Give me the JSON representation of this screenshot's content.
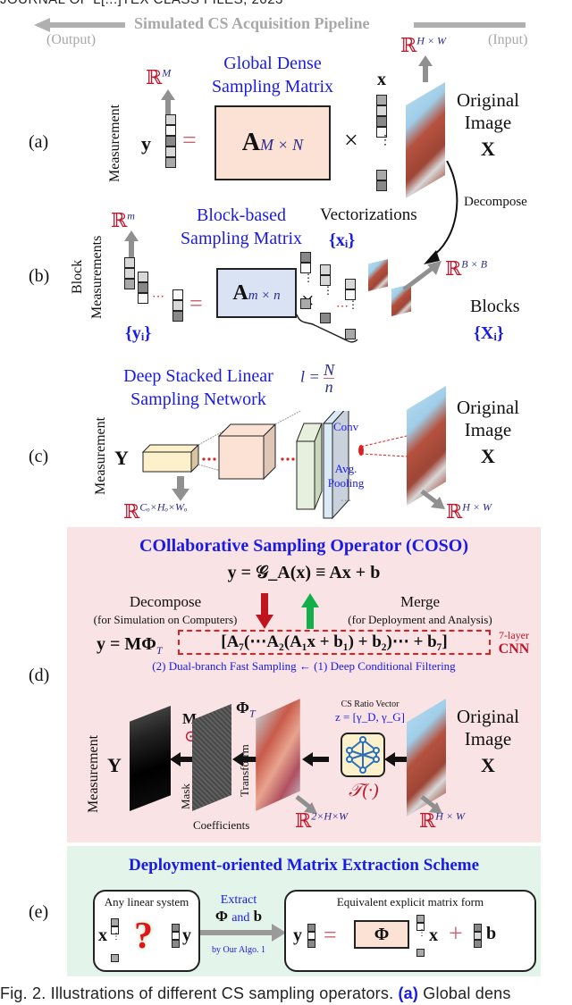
{
  "header": {
    "running_title": "JOURNAL OF L[...]TEX CLASS FILES, 2023"
  },
  "pipeline": {
    "title": "Simulated CS Acquisition Pipeline",
    "output_label": "(Output)",
    "input_label": "(Input)"
  },
  "panel_a": {
    "label": "(a)",
    "side_label": "Measurement",
    "title_line1": "Global Dense",
    "title_line2": "Sampling Matrix",
    "measurement_space": "ℝ",
    "measurement_space_sup": "M",
    "y_symbol": "y",
    "equals": "=",
    "matrix_symbol": "A",
    "matrix_sub": "M × N",
    "times": "×",
    "x_symbol": "x",
    "image_space": "ℝ",
    "image_space_sup": "H × W",
    "image_label_line1": "Original",
    "image_label_line2": "Image",
    "image_symbol": "X",
    "decompose_label": "Decompose",
    "vectorizations_label": "Vectorizations"
  },
  "panel_b": {
    "label": "(b)",
    "side_label_line1": "Block",
    "side_label_line2": "Measurements",
    "title_line1": "Block-based",
    "title_line2": "Sampling Matrix",
    "measurement_space": "ℝ",
    "measurement_space_sup": "m",
    "y_set": "{yᵢ}",
    "matrix_symbol": "A",
    "matrix_sub": "m × n",
    "x_set": "{xᵢ}",
    "block_space": "ℝ",
    "block_space_sup": "B × B",
    "blocks_label": "Blocks",
    "blocks_set": "{Xᵢ}",
    "l_formula_lhs": "l =",
    "l_formula_num": "N",
    "l_formula_den": "n"
  },
  "panel_c": {
    "label": "(c)",
    "side_label": "Measurement",
    "title_line1": "Deep Stacked Linear",
    "title_line2": "Sampling Network",
    "y_symbol": "Y",
    "measurement_space": "ℝ",
    "measurement_space_sup": "Cₒ×Hₒ×Wₒ",
    "conv_label": "Conv",
    "pool_label_line1": "Avg.",
    "pool_label_line2": "Pooling",
    "ellipsis": "…",
    "image_label_line1": "Original",
    "image_label_line2": "Image",
    "image_symbol": "X",
    "image_space": "ℝ",
    "image_space_sup": "H × W"
  },
  "panel_d": {
    "label": "(d)",
    "title": "COllaborative Sampling Operator (COSO)",
    "eq_main": "y = 𝒢_A(x) ≡ Ax + b",
    "decompose_label": "Decompose",
    "decompose_note": "(for Simulation on Computers)",
    "merge_label": "Merge",
    "merge_note": "(for Deployment and Analysis)",
    "eq_expanded_prefix": "y = MΦ",
    "eq_expanded_prefix_sub": "T",
    "eq_expanded_bracket": "[A₇(⋯A₂(A₁x + b₁) + b₂)⋯ + b₇]",
    "cnn_note_line1": "7-layer",
    "cnn_note_line2": "CNN",
    "flow_note": "(2) Dual-branch Fast Sampling  ←  (1) Deep Conditional Filtering",
    "side_label": "Measurement",
    "y_symbol": "Y",
    "mask_symbol": "M",
    "hadamard": "⊙",
    "mask_label": "Mask",
    "coefficients_label": "Coefficients",
    "transform_symbol": "Φ",
    "transform_sub": "T",
    "transform_label": "Transfo-rm",
    "cs_ratio_label": "CS Ratio Vector",
    "cs_ratio_eq": "z = [γ_D, γ_G]",
    "filter_symbol": "𝒯(·)",
    "filter_space": "ℝ",
    "filter_space_sup": "2×H×W",
    "image_label_line1": "Original",
    "image_label_line2": "Image",
    "image_symbol": "X",
    "image_space": "ℝ",
    "image_space_sup": "H × W"
  },
  "panel_e": {
    "label": "(e)",
    "title": "Deployment-oriented Matrix Extraction Scheme",
    "left_box_title": "Any linear system",
    "x_symbol": "x",
    "unknown_glyph": "?",
    "y_symbol": "y",
    "arrow_top": "Extract",
    "arrow_mid_phi": "Φ",
    "arrow_mid_and": "and",
    "arrow_mid_b": "b",
    "arrow_bottom": "by Our Algo. 1",
    "right_box_title": "Equivalent explicit matrix form",
    "right_y": "y",
    "right_equals": "=",
    "right_matrix": "Φ",
    "right_x": "x",
    "right_plus": "+",
    "right_b": "b"
  },
  "caption": {
    "prefix": "Fig. 2. Illustrations of different CS sampling operators.",
    "link": "(a)",
    "suffix": "Global dens"
  },
  "colors": {
    "accent_blue": "#1a1ae6",
    "accent_red": "#c0142a",
    "panel_d_bg": "#f9e3e4",
    "panel_e_bg": "#e3f4ea",
    "matrix_a_fill": "#fbe2d4",
    "matrix_b_fill": "#d9e3f3"
  }
}
